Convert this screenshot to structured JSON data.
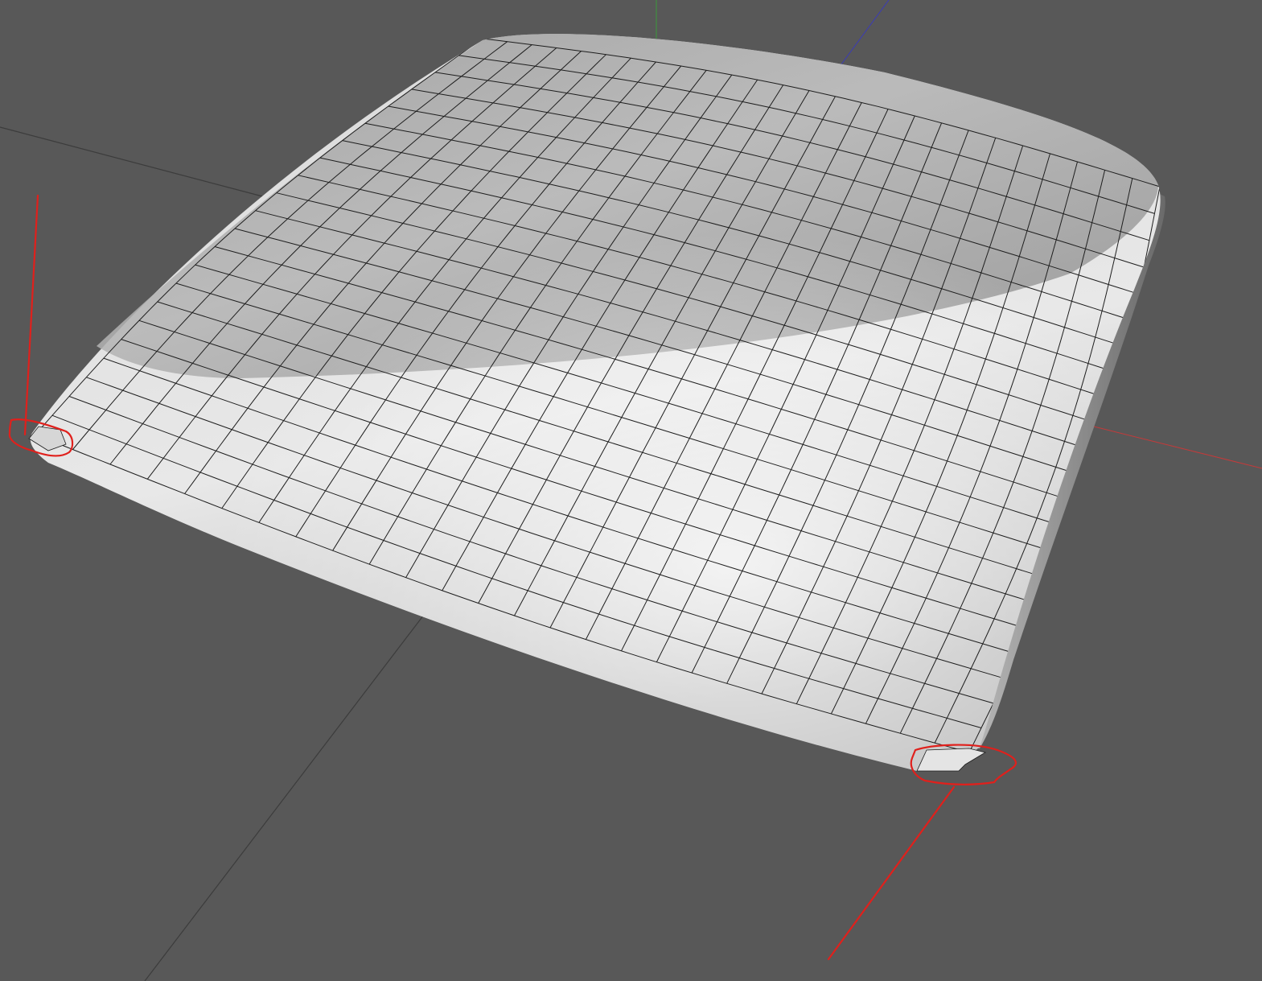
{
  "viewport": {
    "background": "#585858",
    "grid_line_color": "#3c3c3c",
    "axis_colors": {
      "x": "#c43a3a",
      "y": "#3a9a3a",
      "z": "#3a3ab8"
    }
  },
  "object": {
    "type": "cushion-mesh",
    "grid_rows": 22,
    "grid_cols": 26,
    "wire_color": "#1e1e1e",
    "shade_light": "#f4f4f4",
    "shade_dark": "#6e6e6e"
  },
  "annotations": {
    "color": "#e0201c",
    "marks": [
      "left-corner-circle",
      "right-corner-circle",
      "left-pointer-line",
      "right-pointer-line"
    ]
  }
}
